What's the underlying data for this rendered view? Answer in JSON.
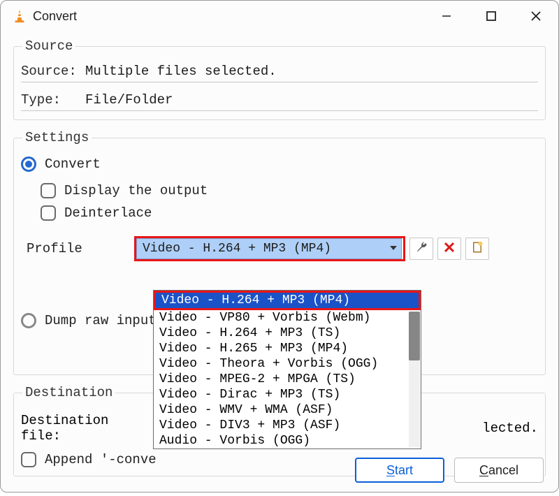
{
  "window": {
    "title": "Convert"
  },
  "source": {
    "group": "Source",
    "label_source": "Source:",
    "value_source": "Multiple files selected.",
    "label_type": "Type:",
    "value_type": "File/Folder"
  },
  "settings": {
    "group": "Settings",
    "radio_convert": "Convert",
    "chk_display": "Display the output",
    "chk_deinterlace": "Deinterlace",
    "profile_label": "Profile",
    "profile_selected": "Video - H.264 + MP3 (MP4)",
    "dropdown_options": [
      "Video - H.264 + MP3 (MP4)",
      "Video - VP80 + Vorbis (Webm)",
      "Video - H.264 + MP3 (TS)",
      "Video - H.265 + MP3 (MP4)",
      "Video - Theora + Vorbis (OGG)",
      "Video - MPEG-2 + MPGA (TS)",
      "Video - Dirac + MP3 (TS)",
      "Video - WMV + WMA (ASF)",
      "Video - DIV3 + MP3 (ASF)",
      "Audio - Vorbis (OGG)"
    ],
    "radio_dump": "Dump raw input"
  },
  "destination": {
    "group": "Destination",
    "label": "Destination file:",
    "value_visible_tail": "lected.",
    "chk_append": "Append '-conve"
  },
  "buttons": {
    "start": "Start",
    "cancel": "Cancel"
  }
}
